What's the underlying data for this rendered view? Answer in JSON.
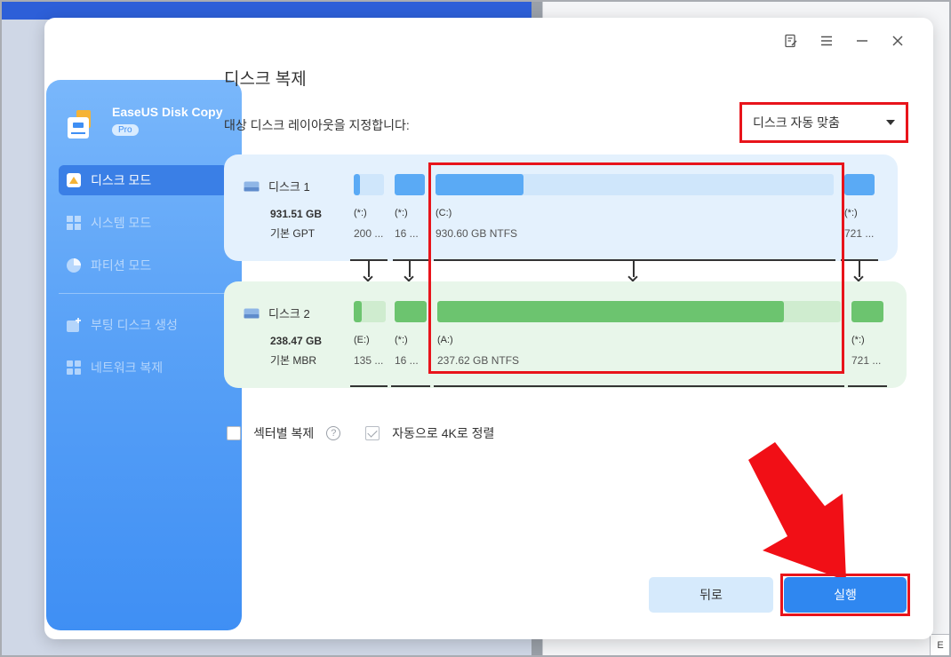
{
  "window": {
    "title": "디스크 복제",
    "titlebar_icons": [
      "feedback-icon",
      "menu-icon",
      "minimize-icon",
      "close-icon"
    ]
  },
  "sidebar": {
    "brand": "EaseUS Disk Copy",
    "badge": "Pro",
    "items": [
      {
        "label": "디스크 모드",
        "icon": "disk-mode-icon",
        "active": true
      },
      {
        "label": "시스템 모드",
        "icon": "windows-icon",
        "active": false
      },
      {
        "label": "파티션 모드",
        "icon": "partition-pie-icon",
        "active": false
      },
      {
        "label": "부팅 디스크 생성",
        "icon": "boot-disk-icon",
        "active": false
      },
      {
        "label": "네트워크 복제",
        "icon": "network-clone-icon",
        "active": false
      }
    ]
  },
  "layout": {
    "label": "대상 디스크 레이아웃을 지정합니다:",
    "selected": "디스크 자동 맞춤"
  },
  "source_disk": {
    "name": "디스크 1",
    "size": "931.51 GB",
    "type": "기본 GPT",
    "partitions": [
      {
        "letter": "(*:)",
        "info": "200 ...",
        "used_fraction": 0.2
      },
      {
        "letter": "(*:)",
        "info": "16 ...",
        "used_fraction": 1.0
      },
      {
        "letter": "(C:)",
        "info": "930.60 GB NTFS",
        "used_fraction": 0.22
      },
      {
        "letter": "(*:)",
        "info": "721 ...",
        "used_fraction": 1.0
      }
    ]
  },
  "target_disk": {
    "name": "디스크 2",
    "size": "238.47 GB",
    "type": "기본 MBR",
    "partitions": [
      {
        "letter": "(E:)",
        "info": "135 ...",
        "used_fraction": 0.25
      },
      {
        "letter": "(*:)",
        "info": "16 ...",
        "used_fraction": 1.0
      },
      {
        "letter": "(A:)",
        "info": "237.62 GB NTFS",
        "used_fraction": 0.86
      },
      {
        "letter": "(*:)",
        "info": "721 ...",
        "used_fraction": 1.0
      }
    ]
  },
  "options": {
    "sector_clone": "섹터별 복제",
    "sector_clone_checked": false,
    "align_4k": "자동으로 4K로 정렬",
    "align_4k_checked": true
  },
  "buttons": {
    "back": "뒤로",
    "run": "실행"
  },
  "colors": {
    "accent": "#2f87f0",
    "highlight": "#e8141b",
    "source_fill": "#5aaaf5",
    "target_fill": "#6cc46f"
  },
  "corner": "E"
}
